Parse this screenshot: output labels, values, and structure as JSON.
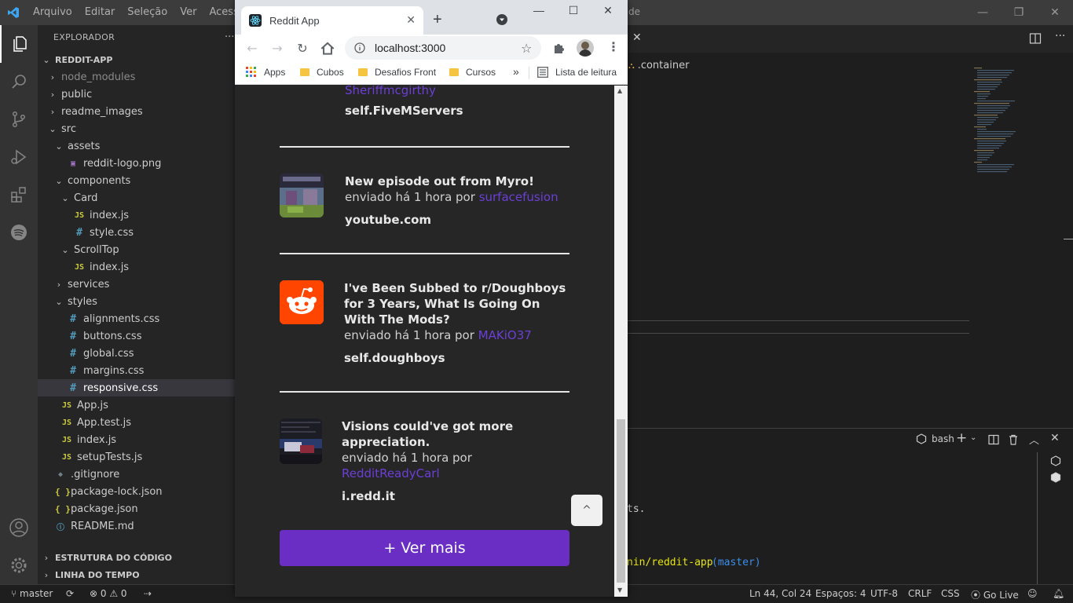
{
  "vscode": {
    "menu": [
      "Arquivo",
      "Editar",
      "Seleção",
      "Ver",
      "Acessar"
    ],
    "title_fragment": "de",
    "explorer_title": "EXPLORADOR",
    "project": "REDDIT-APP",
    "tree": [
      {
        "label": "node_modules",
        "type": "folder",
        "collapsed": true
      },
      {
        "label": "public",
        "type": "folder",
        "collapsed": true
      },
      {
        "label": "readme_images",
        "type": "folder",
        "collapsed": true
      },
      {
        "label": "src",
        "type": "folder",
        "collapsed": false
      },
      {
        "label": "assets",
        "type": "folder",
        "collapsed": false
      },
      {
        "label": "reddit-logo.png",
        "type": "image"
      },
      {
        "label": "components",
        "type": "folder",
        "collapsed": false
      },
      {
        "label": "Card",
        "type": "folder",
        "collapsed": false
      },
      {
        "label": "index.js",
        "type": "js"
      },
      {
        "label": "style.css",
        "type": "css"
      },
      {
        "label": "ScrollTop",
        "type": "folder",
        "collapsed": false
      },
      {
        "label": "index.js",
        "type": "js"
      },
      {
        "label": "services",
        "type": "folder",
        "collapsed": true
      },
      {
        "label": "styles",
        "type": "folder",
        "collapsed": false
      },
      {
        "label": "alignments.css",
        "type": "css"
      },
      {
        "label": "buttons.css",
        "type": "css"
      },
      {
        "label": "global.css",
        "type": "css"
      },
      {
        "label": "margins.css",
        "type": "css"
      },
      {
        "label": "responsive.css",
        "type": "css",
        "selected": true
      },
      {
        "label": "App.js",
        "type": "js"
      },
      {
        "label": "App.test.js",
        "type": "js"
      },
      {
        "label": "index.js",
        "type": "js"
      },
      {
        "label": "setupTests.js",
        "type": "js"
      },
      {
        "label": ".gitignore",
        "type": "git"
      },
      {
        "label": "package-lock.json",
        "type": "json"
      },
      {
        "label": "package.json",
        "type": "json"
      },
      {
        "label": "README.md",
        "type": "info"
      }
    ],
    "outline_label": "ESTRUTURA DO CÓDIGO",
    "timeline_label": "LINHA DO TEMPO",
    "breadcrumb": ".container",
    "terminal": {
      "shell": "bash",
      "line1": "ts.",
      "path": "nin/reddit-app",
      "branch": "(master)"
    },
    "status": {
      "branch": "master",
      "errors": "0",
      "warnings": "0",
      "position": "Ln 44, Col 24",
      "spaces": "Espaços: 4",
      "encoding": "UTF-8",
      "eol": "CRLF",
      "language": "CSS",
      "golive": "Go Live"
    }
  },
  "chrome": {
    "tab_title": "Reddit App",
    "url": "localhost:3000",
    "bookmarks": [
      "Apps",
      "Cubos",
      "Desafios Front",
      "Cursos"
    ],
    "reading_list": "Lista de leitura",
    "chevron": "»"
  },
  "feed": {
    "partial_author": "Sheriffmcgirthy",
    "partial_domain": "self.FiveMServers",
    "posts": [
      {
        "title": "New episode out from Myro!",
        "meta_prefix": "enviado há 1 hora por",
        "author": "surfacefusion",
        "domain": "youtube.com",
        "thumb": "video-thumbnail"
      },
      {
        "title": "I've Been Subbed to r/Doughboys for 3 Years, What Is Going On With The Mods?",
        "meta_prefix": "enviado há 1 hora por",
        "author": "MAKiO37",
        "domain": "self.doughboys",
        "thumb": "reddit-logo"
      },
      {
        "title": "Visions could've got more appreciation.",
        "meta_prefix": "enviado há 1 hora por",
        "author": "RedditReadyCarl",
        "domain": "i.redd.it",
        "thumb": "image-thumbnail"
      }
    ],
    "scroll_top_label": "^",
    "more_button": "+ Ver mais"
  },
  "colors": {
    "accent": "#6a2ec5",
    "author": "#6b3fd6",
    "page_bg": "#262626",
    "vscode_bg": "#1e1e1e"
  }
}
